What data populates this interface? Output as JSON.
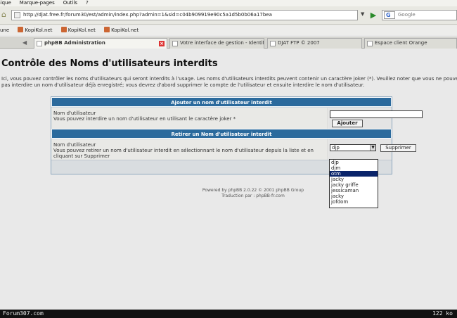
{
  "menu": [
    "ionique",
    "Marque-pages",
    "Outils",
    "?"
  ],
  "navbar": {
    "url": "http://djat.free.fr/forum30/est/admin/index.php?admin=1&sid=c04b909919e90c5a1d5b0b06a17bea",
    "search_placeholder": "Google",
    "search_engine_letter": "G"
  },
  "bookmarks": [
    "une",
    "KopiKol.net",
    "KopiKol.net",
    "KopiKol.net"
  ],
  "tabs": [
    {
      "label": "phpBB Administration",
      "active": true
    },
    {
      "label": "Votre interface de gestion - Identifiez-vous",
      "active": false
    },
    {
      "label": "DJAT FTP © 2007",
      "active": false
    },
    {
      "label": "Espace client Orange",
      "active": false
    }
  ],
  "page": {
    "title": "Contrôle des Noms d'utilisateurs interdits",
    "intro": "Ici, vous pouvez contrôler les noms d'utilisateurs qui seront interdits à l'usage. Les noms d'utilisateurs interdits peuvent contenir un caractère joker (*). Veuillez noter que vous ne pouvez pas interdire un nom d'utilisateur déjà enregistré; vous devrez d'abord supprimer le compte de l'utilisateur et ensuite interdire le nom d'utilisateur.",
    "add_section": {
      "header": "Ajouter un nom d'utilisateur interdit",
      "label": "Nom d'utilisateur",
      "help": "Vous pouvez interdire un nom d'utilisateur en utilisant le caractère joker *",
      "button": "Ajouter",
      "input_value": ""
    },
    "remove_section": {
      "header": "Retirer un Nom d'utilisateur interdit",
      "label": "Nom d'utilisateur",
      "help": "Vous pouvez retirer un nom d'utilisateur interdit en sélectionnant le nom d'utilisateur depuis la liste et en cliquant sur Supprimer",
      "selected": "djp",
      "button": "Supprimer",
      "options": [
        "djp",
        "djm",
        "otm",
        "jacky",
        "jacky griffe",
        "jessicaman",
        "jacky",
        "jofdom"
      ],
      "highlighted_index": 2
    },
    "powered_line1": "Powered by phpBB 2.0.22 © 2001 phpBB Group",
    "powered_line2": "Traduction par : phpBB-fr.com"
  },
  "statusbar": {
    "left": "Forum307.com",
    "right": "122 ko"
  },
  "colors": {
    "panel_header": "#2b6a9d",
    "selected_option": "#0a246a"
  }
}
